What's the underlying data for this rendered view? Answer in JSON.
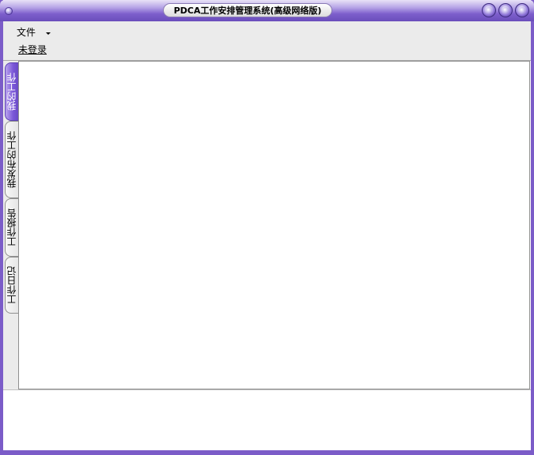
{
  "window": {
    "title": "PDCA工作安排管理系统(高级网络版)"
  },
  "menu": {
    "file_label": "文件"
  },
  "account": {
    "login_status": "未登录"
  },
  "tabs": [
    {
      "label": "我的工作",
      "active": true
    },
    {
      "label": "我发布的工作",
      "active": false
    },
    {
      "label": "工作报告",
      "active": false
    },
    {
      "label": "工作日记",
      "active": false
    }
  ],
  "theme": {
    "frame_color": "#7b5cc8",
    "active_tab_color": "#7b58d8",
    "panel_bg": "#ebebeb"
  }
}
